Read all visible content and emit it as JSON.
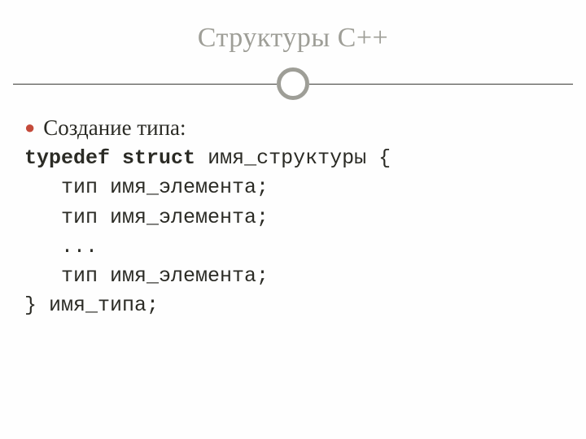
{
  "title": "Структуры С++",
  "bullet": "●",
  "heading": "Создание типа:",
  "code": {
    "kw1": "typedef",
    "kw2": "struct",
    "l1_rest": " имя_структуры {",
    "l2": "   тип имя_элемента;",
    "l3": "   тип имя_элемента;",
    "l4": "   ...",
    "l5": "   тип имя_элемента;",
    "l6": "} имя_типа;"
  }
}
